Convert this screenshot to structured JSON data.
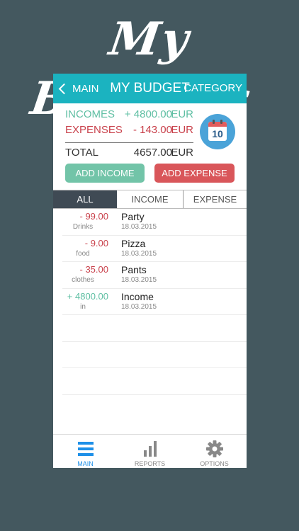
{
  "banner": {
    "title": "My Budgets"
  },
  "navbar": {
    "back_label": "MAIN",
    "title": "MY BUDGET",
    "right_label": "CATEGORY"
  },
  "summary": {
    "incomes_label": "INCOMES",
    "incomes_value": "+ 4800.00",
    "incomes_currency": "EUR",
    "expenses_label": "EXPENSES",
    "expenses_value": "- 143.00",
    "expenses_currency": "EUR",
    "total_label": "TOTAL",
    "total_value": "4657.00",
    "total_currency": "EUR",
    "calendar_day": "10"
  },
  "buttons": {
    "add_income": "ADD INCOME",
    "add_expense": "ADD EXPENSE"
  },
  "tabs": [
    {
      "label": "ALL"
    },
    {
      "label": "INCOME"
    },
    {
      "label": "EXPENSE"
    }
  ],
  "transactions": [
    {
      "amount": "- 99.00",
      "category": "Drinks",
      "name": "Party",
      "date": "18.03.2015"
    },
    {
      "amount": "- 9.00",
      "category": "food",
      "name": "Pizza",
      "date": "18.03.2015"
    },
    {
      "amount": "- 35.00",
      "category": "clothes",
      "name": "Pants",
      "date": "18.03.2015"
    },
    {
      "amount": "+ 4800.00",
      "category": "in",
      "name": "Income",
      "date": "18.03.2015"
    }
  ],
  "tabbar": [
    {
      "label": "MAIN",
      "icon": "menu-icon"
    },
    {
      "label": "REPORTS",
      "icon": "bar-chart-icon"
    },
    {
      "label": "OPTIONS",
      "icon": "gear-icon"
    }
  ],
  "colors": {
    "accent": "#1bb3c0",
    "income": "#5fbfa3",
    "expense": "#c9424c",
    "background": "#44585f",
    "active_tab": "#1e90e8"
  }
}
